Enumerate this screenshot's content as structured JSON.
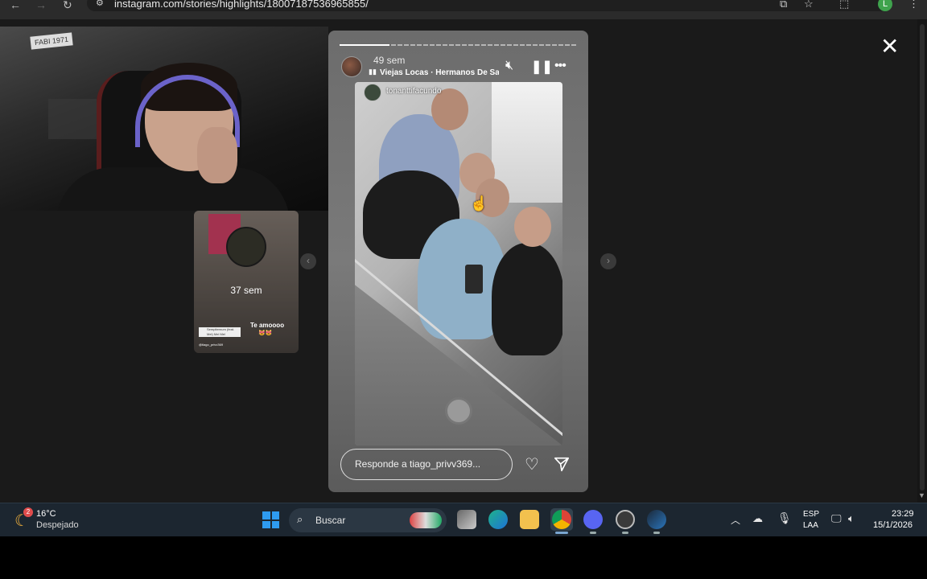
{
  "browser": {
    "url": "instagram.com/stories/highlights/18007187536965855/",
    "profile_initial": "L"
  },
  "prev_story": {
    "time": "37 sem",
    "caption": "Te amoooo",
    "hearts": "😻😻",
    "mini_label": "Sempiternum (feat. Mel) Mel Mel",
    "user": "@tiago_privv369"
  },
  "story": {
    "time": "49 sem",
    "music_title": "Viejas Locas · Hermanos De Sangre",
    "tagged_user": "tonanttifacundo",
    "reply_placeholder": "Responde a tiago_privv369...",
    "progress_fraction": 0.21
  },
  "webcam": {
    "sign_text": "FABI 1971"
  },
  "taskbar": {
    "temperature": "16°C",
    "condition": "Despejado",
    "weather_badge": "2",
    "search_placeholder": "Buscar",
    "lang_line1": "ESP",
    "lang_line2": "LAA",
    "time": "23:29",
    "date": "15/1/2026"
  },
  "colors": {
    "accent_blue": "#2e9bf0",
    "taskbar_bg": "#1c2630"
  }
}
